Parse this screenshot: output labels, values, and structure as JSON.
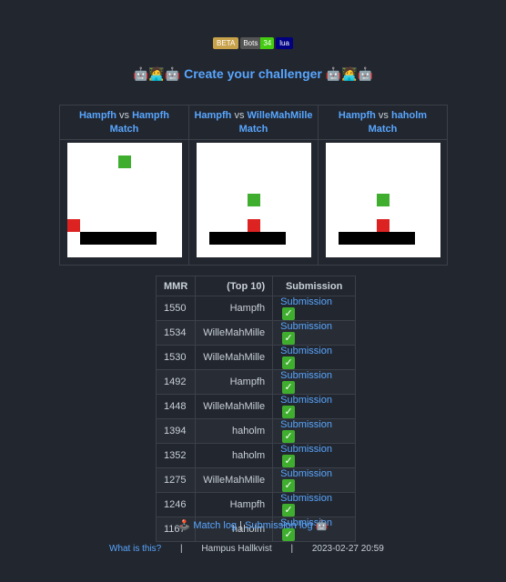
{
  "badges": {
    "beta": "BETA",
    "bots_label": "Bots",
    "bots_count": "34",
    "lang": "lua"
  },
  "header": {
    "emoji_left": "🤖🧑‍💻🤖",
    "title": "Create your challenger",
    "emoji_right": "🤖🧑‍💻🤖"
  },
  "matches": [
    {
      "player1": "Hampfh",
      "vs": "vs",
      "player2": "Hampfh",
      "match": "Match"
    },
    {
      "player1": "Hampfh",
      "vs": "vs",
      "player2": "WilleMahMille",
      "match": "Match"
    },
    {
      "player1": "Hampfh",
      "vs": "vs",
      "player2": "haholm",
      "match": "Match"
    }
  ],
  "scoreboard": {
    "headers": {
      "mmr": "MMR",
      "name": "(Top 10)",
      "submission": "Submission"
    },
    "rows": [
      {
        "mmr": "1550",
        "name": "Hampfh",
        "submission": "Submission",
        "check": "✓"
      },
      {
        "mmr": "1534",
        "name": "WilleMahMille",
        "submission": "Submission",
        "check": "✓"
      },
      {
        "mmr": "1530",
        "name": "WilleMahMille",
        "submission": "Submission",
        "check": "✓"
      },
      {
        "mmr": "1492",
        "name": "Hampfh",
        "submission": "Submission",
        "check": "✓"
      },
      {
        "mmr": "1448",
        "name": "WilleMahMille",
        "submission": "Submission",
        "check": "✓"
      },
      {
        "mmr": "1394",
        "name": "haholm",
        "submission": "Submission",
        "check": "✓"
      },
      {
        "mmr": "1352",
        "name": "haholm",
        "submission": "Submission",
        "check": "✓"
      },
      {
        "mmr": "1275",
        "name": "WilleMahMille",
        "submission": "Submission",
        "check": "✓"
      },
      {
        "mmr": "1246",
        "name": "Hampfh",
        "submission": "Submission",
        "check": "✓"
      },
      {
        "mmr": "1167",
        "name": "haholm",
        "submission": "Submission",
        "check": "✓"
      }
    ]
  },
  "logs": {
    "joystick": "🕹️",
    "match_log": "Match log",
    "sep": "|",
    "submission_log": "Submission log",
    "robot": "🤖"
  },
  "footer": {
    "what_is_this": "What is this?",
    "sep": "|",
    "author": "Hampus Hallkvist",
    "timestamp": "2023-02-27 20:59"
  },
  "colors": {
    "background": "#22262e",
    "link": "#58a6ff",
    "green_piece": "#3fae2f",
    "red_piece": "#dd2222"
  }
}
